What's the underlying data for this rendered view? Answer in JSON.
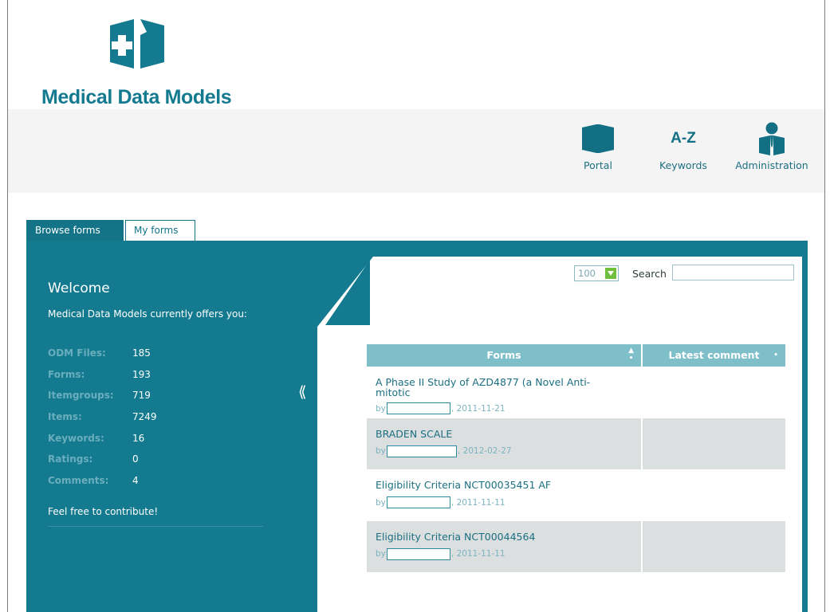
{
  "brand": {
    "name": "Medical Data Models",
    "color": "#137a90"
  },
  "nav": [
    {
      "label": "Portal",
      "icon": "portal-icon"
    },
    {
      "label": "Keywords",
      "icon_text": "A-Z"
    },
    {
      "label": "Administration",
      "icon": "user-icon"
    }
  ],
  "tabs": [
    {
      "label": "Browse forms",
      "active": true
    },
    {
      "label": "My forms",
      "active": false
    }
  ],
  "sidebar": {
    "title": "Welcome",
    "intro": "Medical Data Models currently offers you:",
    "stats": [
      {
        "label": "ODM Files:",
        "value": "185"
      },
      {
        "label": "Forms:",
        "value": "193"
      },
      {
        "label": "Itemgroups:",
        "value": "719"
      },
      {
        "label": "Items:",
        "value": "7249"
      },
      {
        "label": "Keywords:",
        "value": "16"
      },
      {
        "label": "Ratings:",
        "value": "0"
      },
      {
        "label": "Comments:",
        "value": "4"
      }
    ],
    "footer": "Feel free to contribute!",
    "collapse_glyph": "⟪"
  },
  "controls": {
    "page_size": "100",
    "search_label": "Search",
    "search_value": ""
  },
  "table": {
    "columns": [
      "Forms",
      "Latest comment"
    ],
    "rows": [
      {
        "title": "A Phase II Study of AZD4877 (a Novel Anti-mitotic",
        "by": "by",
        "date": ", 2011-11-21"
      },
      {
        "title": "BRADEN SCALE",
        "by": "by",
        "date": ", 2012-02-27"
      },
      {
        "title": "Eligibility Criteria NCT00035451 AF",
        "by": "by",
        "date": ", 2011-11-11"
      },
      {
        "title": "Eligibility Criteria NCT00044564",
        "by": "by",
        "date": ", 2011-11-11"
      }
    ]
  },
  "colors": {
    "panel": "#137a8f",
    "header": "#7fbfca",
    "row_alt": "#dcdfe0",
    "link": "#1c6f82"
  }
}
